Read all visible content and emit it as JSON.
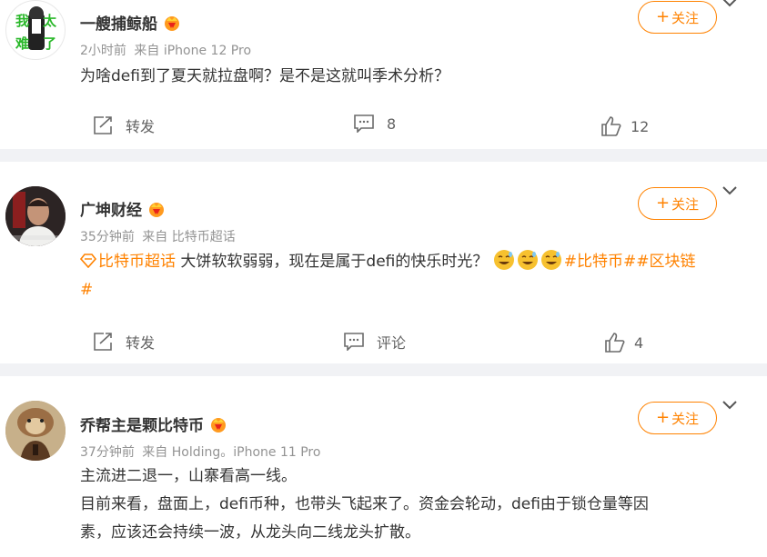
{
  "colors": {
    "accent": "#ff8200",
    "text": "#333333",
    "meta": "#939393",
    "action": "#636363",
    "background": "#f1f2f5"
  },
  "posts": [
    {
      "avatar_text": [
        "我",
        "太",
        "难",
        "了"
      ],
      "author": "一艘捕鲸船",
      "time": "2小时前",
      "source": "来自 iPhone 12 Pro",
      "content": "为啥defi到了夏天就拉盘啊？是不是这就叫季术分析？",
      "follow_label": "关注",
      "repost_label": "转发",
      "comment_label": "8",
      "like_count": "12"
    },
    {
      "author": "广坤财经",
      "time": "35分钟前",
      "source": "来自 比特币超话",
      "supertopic": "比特币超话",
      "content": "大饼软软弱弱，现在是属于defi的快乐时光？",
      "emoji_icon": "grinning-sweat-emoji",
      "hashtags_line1": "#比特币##区块链",
      "hashtags_line2": "#",
      "follow_label": "关注",
      "repost_label": "转发",
      "comment_label": "评论",
      "like_count": "4"
    },
    {
      "author": "乔帮主是颗比特币",
      "time": "37分钟前",
      "source": "来自 Holding。iPhone 11 Pro",
      "line1": "主流进二退一，山寨看高一线。",
      "line2": "目前来看，盘面上，defi币种，也带头飞起来了。资金会轮动，defi由于锁仓量等因",
      "line3": "素，应该还会持续一波，从龙头向二线龙头扩散。",
      "follow_label": "关注"
    }
  ],
  "icons": {
    "repost": "repost-icon",
    "comment": "comment-icon",
    "like": "like-icon",
    "more": "chevron-down-icon",
    "vip": "vip-badge-icon",
    "supertopic": "supertopic-icon"
  }
}
